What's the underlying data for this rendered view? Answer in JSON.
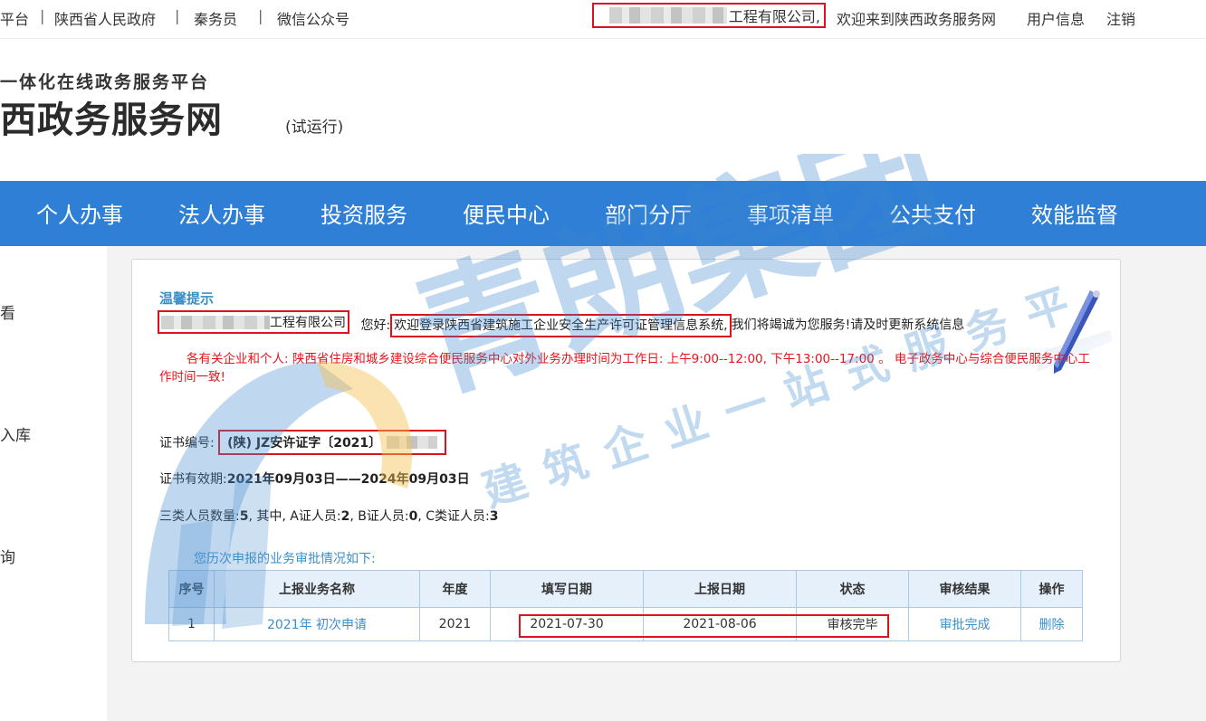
{
  "topbar": {
    "platform_fragment": "平台",
    "provincial_gov": "陕西省人民政府",
    "qinwuyuan": "秦务员",
    "wechat": "微信公众号",
    "company_suffix": "工程有限公司,",
    "welcome": "欢迎来到陕西政务服务网",
    "user_info": "用户信息",
    "logout": "注销",
    "separator": "|"
  },
  "header": {
    "subtitle": "一体化在线政务服务平台",
    "title": "西政务服务网",
    "trial": "(试运行)"
  },
  "nav": {
    "items": [
      "个人办事",
      "法人办事",
      "投资服务",
      "便民中心",
      "部门分厅",
      "事项清单",
      "公共支付",
      "效能监督"
    ]
  },
  "left_sidebar": {
    "items": [
      "看",
      "入库",
      "询"
    ]
  },
  "panel": {
    "tip_title": "温馨提示",
    "company_suffix": "工程有限公司",
    "greeting": "您好:",
    "welcome_system": "欢迎登录陕西省建筑施工企业安全生产许可证管理信息系统,",
    "service_note": "我们将竭诚为您服务!请及时更新系统信息",
    "notice": "各有关企业和个人: 陕西省住房和城乡建设综合便民服务中心对外业务办理时间为工作日: 上午9:00--12:00, 下午13:00--17:00 。 电子政务中心与综合便民服务中心工作时间一致!",
    "cert_no_label": "证书编号:",
    "cert_no_value": "(陕) JZ安许证字〔2021〕",
    "validity_label": "证书有效期:",
    "validity_value": "2021年09月03日——2024年09月03日",
    "counts_label": "三类人员数量:",
    "counts_total": "5",
    "counts_mid": ", 其中, A证人员:",
    "counts_a": "2",
    "counts_b_label": ",  B证人员:",
    "counts_b": "0",
    "counts_c_label": ",  C类证人员:",
    "counts_c": "3",
    "history_title": "您历次申报的业务审批情况如下:"
  },
  "table": {
    "headers": [
      "序号",
      "上报业务名称",
      "年度",
      "填写日期",
      "上报日期",
      "状态",
      "审核结果",
      "操作"
    ],
    "rows": [
      {
        "index": "1",
        "name": "2021年 初次申请",
        "year": "2021",
        "fill_date": "2021-07-30",
        "submit_date": "2021-08-06",
        "status": "审核完毕",
        "result": "审批完成",
        "action": "删除"
      }
    ]
  },
  "watermark": {
    "main": "青朗集团",
    "sub": "建筑企业一站式服务平台"
  },
  "colors": {
    "nav_blue": "#2f7fd6",
    "tip_blue": "#3b8fc9",
    "notice_red": "#e8141c",
    "highlight_red": "#d9141c"
  }
}
